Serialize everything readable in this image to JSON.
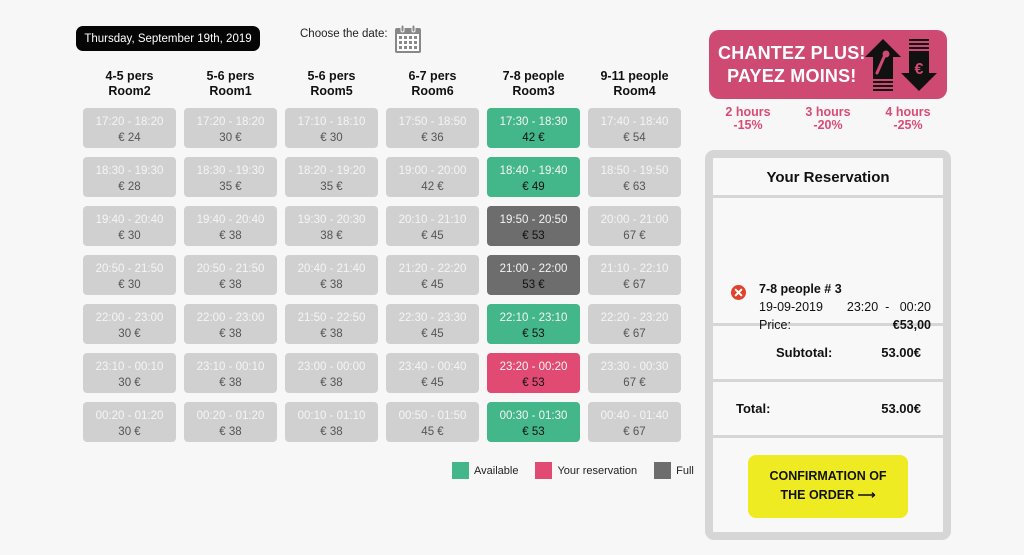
{
  "header": {
    "selected_date": "Thursday, September 19th, 2019",
    "choose_date_label": "Choose the date:",
    "calendar_icon": "calendar-icon"
  },
  "rooms": [
    {
      "capacity": "4-5 pers",
      "name": "Room2",
      "slots": [
        {
          "time": "17:20 - 18:20",
          "price": "€ 24",
          "status": "unavailable"
        },
        {
          "time": "18:30 - 19:30",
          "price": "€ 28",
          "status": "unavailable"
        },
        {
          "time": "19:40 - 20:40",
          "price": "€ 30",
          "status": "unavailable"
        },
        {
          "time": "20:50 - 21:50",
          "price": "€ 30",
          "status": "unavailable"
        },
        {
          "time": "22:00 - 23:00",
          "price": "30 €",
          "status": "unavailable"
        },
        {
          "time": "23:10 - 00:10",
          "price": "30 €",
          "status": "unavailable"
        },
        {
          "time": "00:20 - 01:20",
          "price": "30 €",
          "status": "unavailable"
        }
      ]
    },
    {
      "capacity": "5-6 pers",
      "name": "Room1",
      "slots": [
        {
          "time": "17:20 - 18:20",
          "price": "30 €",
          "status": "unavailable"
        },
        {
          "time": "18:30 - 19:30",
          "price": "35 €",
          "status": "unavailable"
        },
        {
          "time": "19:40 - 20:40",
          "price": "€ 38",
          "status": "unavailable"
        },
        {
          "time": "20:50 - 21:50",
          "price": "€ 38",
          "status": "unavailable"
        },
        {
          "time": "22:00 - 23:00",
          "price": "€ 38",
          "status": "unavailable"
        },
        {
          "time": "23:10 - 00:10",
          "price": "€ 38",
          "status": "unavailable"
        },
        {
          "time": "00:20 - 01:20",
          "price": "€ 38",
          "status": "unavailable"
        }
      ]
    },
    {
      "capacity": "5-6 pers",
      "name": "Room5",
      "slots": [
        {
          "time": "17:10 - 18:10",
          "price": "€ 30",
          "status": "unavailable"
        },
        {
          "time": "18:20 - 19:20",
          "price": "35 €",
          "status": "unavailable"
        },
        {
          "time": "19:30 - 20:30",
          "price": "38 €",
          "status": "unavailable"
        },
        {
          "time": "20:40 - 21:40",
          "price": "€ 38",
          "status": "unavailable"
        },
        {
          "time": "21:50 - 22:50",
          "price": "€ 38",
          "status": "unavailable"
        },
        {
          "time": "23:00 - 00:00",
          "price": "€ 38",
          "status": "unavailable"
        },
        {
          "time": "00:10 - 01:10",
          "price": "€ 38",
          "status": "unavailable"
        }
      ]
    },
    {
      "capacity": "6-7 pers",
      "name": "Room6",
      "slots": [
        {
          "time": "17:50 - 18:50",
          "price": "€ 36",
          "status": "unavailable"
        },
        {
          "time": "19:00 - 20:00",
          "price": "42 €",
          "status": "unavailable"
        },
        {
          "time": "20:10 - 21:10",
          "price": "€ 45",
          "status": "unavailable"
        },
        {
          "time": "21:20 - 22:20",
          "price": "€ 45",
          "status": "unavailable"
        },
        {
          "time": "22:30 - 23:30",
          "price": "€ 45",
          "status": "unavailable"
        },
        {
          "time": "23:40 - 00:40",
          "price": "€ 45",
          "status": "unavailable"
        },
        {
          "time": "00:50 - 01:50",
          "price": "45 €",
          "status": "unavailable"
        }
      ]
    },
    {
      "capacity": "7-8 people",
      "name": "Room3",
      "slots": [
        {
          "time": "17:30 - 18:30",
          "price": "42 €",
          "status": "available"
        },
        {
          "time": "18:40 - 19:40",
          "price": "€ 49",
          "status": "available"
        },
        {
          "time": "19:50 - 20:50",
          "price": "€ 53",
          "status": "full"
        },
        {
          "time": "21:00 - 22:00",
          "price": "53 €",
          "status": "full"
        },
        {
          "time": "22:10 - 23:10",
          "price": "€ 53",
          "status": "available"
        },
        {
          "time": "23:20 - 00:20",
          "price": "€ 53",
          "status": "reserved"
        },
        {
          "time": "00:30 - 01:30",
          "price": "€ 53",
          "status": "available"
        }
      ]
    },
    {
      "capacity": "9-11 people",
      "name": "Room4",
      "slots": [
        {
          "time": "17:40 - 18:40",
          "price": "€ 54",
          "status": "unavailable"
        },
        {
          "time": "18:50 - 19:50",
          "price": "€ 63",
          "status": "unavailable"
        },
        {
          "time": "20:00 - 21:00",
          "price": "67 €",
          "status": "unavailable"
        },
        {
          "time": "21:10 - 22:10",
          "price": "€ 67",
          "status": "unavailable"
        },
        {
          "time": "22:20 - 23:20",
          "price": "€ 67",
          "status": "unavailable"
        },
        {
          "time": "23:30 - 00:30",
          "price": "67 €",
          "status": "unavailable"
        },
        {
          "time": "00:40 - 01:40",
          "price": "€ 67",
          "status": "unavailable"
        }
      ]
    }
  ],
  "legend": [
    {
      "label": "Available",
      "color": "#43b78a"
    },
    {
      "label": "Your reservation",
      "color": "#e04a73"
    },
    {
      "label": "Full",
      "color": "#6d6d6d"
    }
  ],
  "banner": {
    "line1": "CHANTEZ PLUS!",
    "line2": "PAYEZ MOINS!",
    "color": "#cf4a72",
    "icons": [
      "microphone-up-arrow-icon",
      "euro-down-arrow-icon"
    ]
  },
  "discounts": [
    {
      "duration": "2 hours",
      "discount": "-15%"
    },
    {
      "duration": "3 hours",
      "discount": "-20%"
    },
    {
      "duration": "4 hours",
      "discount": "-25%"
    }
  ],
  "reservation": {
    "title": "Your Reservation",
    "item": {
      "name": "7-8 people # 3",
      "date": "19-09-2019",
      "time": "23:20  -   00:20",
      "price_label": "Price:",
      "price": "€53,00"
    },
    "subtotal_label": "Subtotal:",
    "subtotal": "53.00€",
    "total_label": "Total:",
    "total": "53.00€",
    "confirm_line1": "CONFIRMATION OF",
    "confirm_line2": "THE ORDER",
    "confirm_arrow": "⟶"
  },
  "colors": {
    "available": "#43b78a",
    "reserved": "#e04a73",
    "full": "#6d6d6d",
    "unavailable": "#d0d0d0",
    "confirm": "#eeeb22",
    "accent": "#cf4a72"
  }
}
